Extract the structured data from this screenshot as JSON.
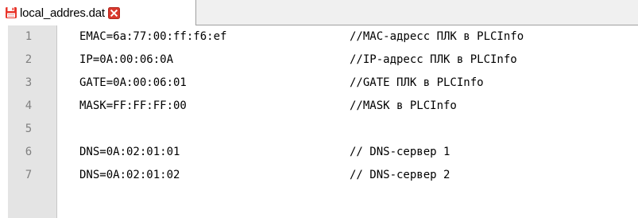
{
  "tab": {
    "filename": "local_addres.dat",
    "save_icon": "floppy-disk-icon",
    "close_icon": "close-icon",
    "save_icon_color": "#e8352b",
    "close_icon_color": "#d9372c"
  },
  "editor": {
    "lines": [
      {
        "number": "1",
        "text": "EMAC=6a:77:00:ff:f6:ef",
        "comment": "//MAC-адресс ПЛК в PLCInfo"
      },
      {
        "number": "2",
        "text": "IP=0A:00:06:0A",
        "comment": "//IP-адресс ПЛК в PLCInfo"
      },
      {
        "number": "3",
        "text": "GATE=0A:00:06:01",
        "comment": "//GATE ПЛК в PLCInfo"
      },
      {
        "number": "4",
        "text": "MASK=FF:FF:FF:00",
        "comment": "//MASK в PLCInfo"
      },
      {
        "number": "5",
        "text": "",
        "comment": ""
      },
      {
        "number": "6",
        "text": "DNS=0A:02:01:01",
        "comment": "// DNS-сервер 1"
      },
      {
        "number": "7",
        "text": "DNS=0A:02:01:02",
        "comment": "// DNS-сервер 2"
      }
    ]
  }
}
